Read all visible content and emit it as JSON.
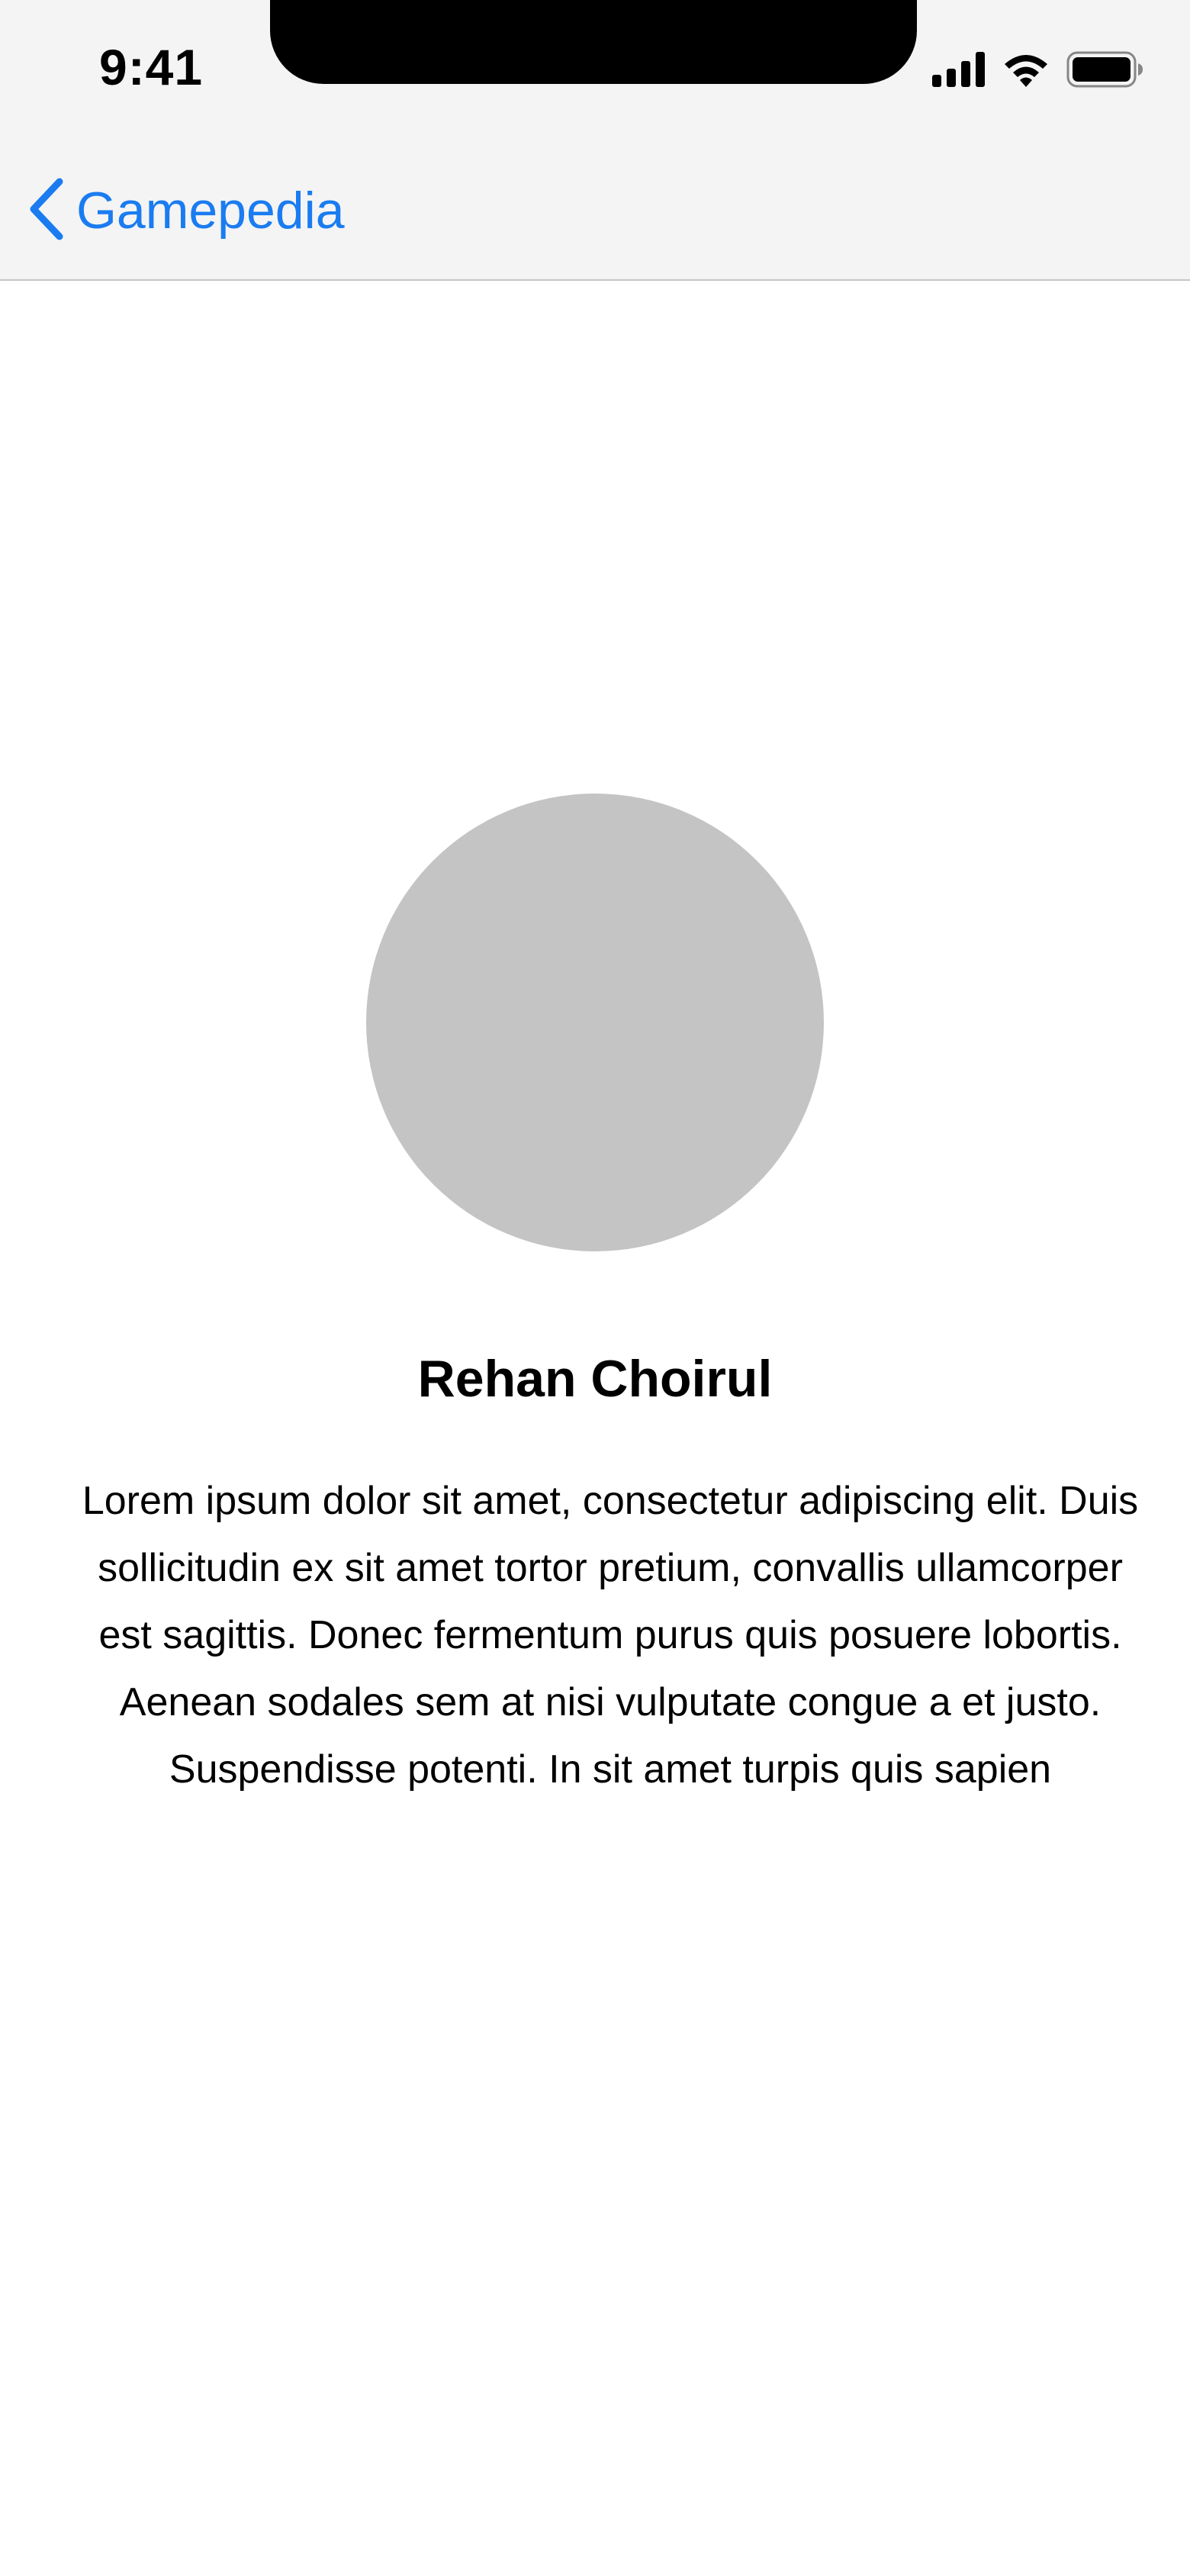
{
  "status_bar": {
    "time": "9:41",
    "icons": [
      "cellular-signal-icon",
      "wifi-icon",
      "battery-icon"
    ]
  },
  "nav": {
    "back_label": "Gamepedia",
    "back_icon": "chevron-left-icon",
    "accent_color": "#1a7cf0"
  },
  "profile": {
    "name": "Rehan Choirul",
    "bio": "Lorem ipsum dolor sit amet, consectetur adipiscing elit. Duis sollicitudin ex sit amet tortor pretium, convallis ullamcorper est sagittis. Donec fermentum purus quis posuere lobortis. Aenean sodales sem at nisi vulputate congue a et justo. Suspendisse potenti. In sit amet turpis quis sapien",
    "avatar_color": "#c4c4c4"
  }
}
